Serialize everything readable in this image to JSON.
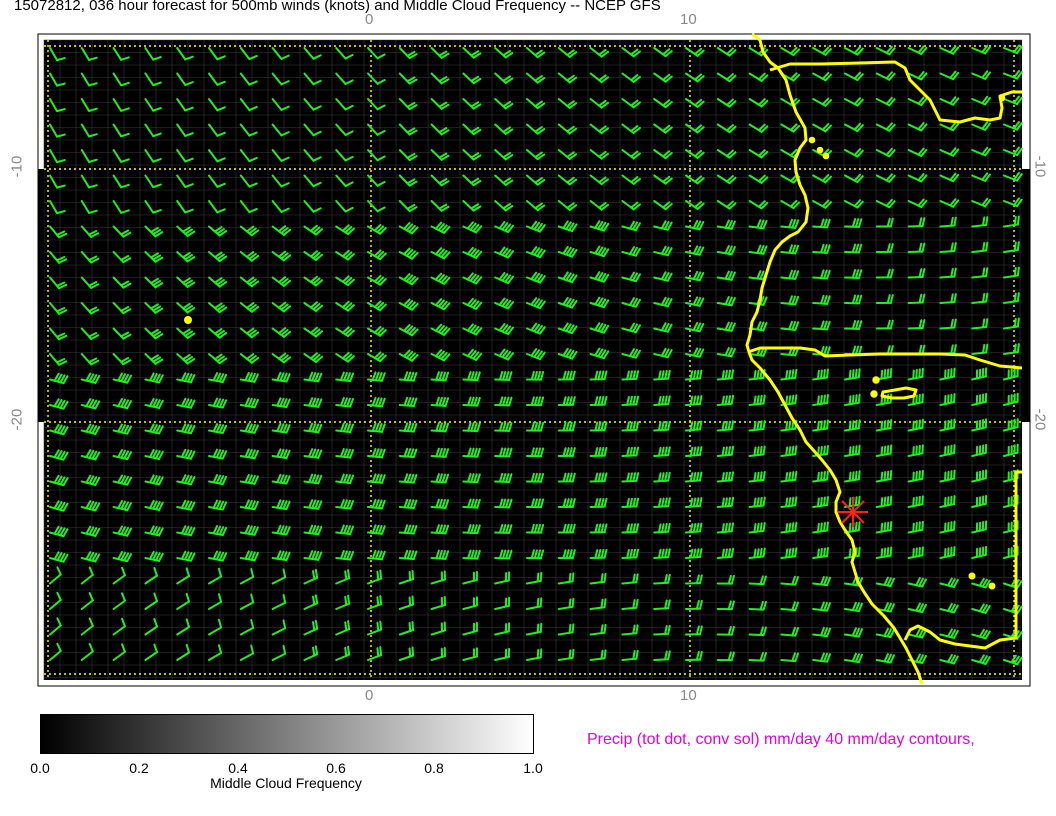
{
  "title": "15072812, 036 hour forecast for 500mb winds (knots) and Middle Cloud Frequency -- NCEP GFS",
  "axes": {
    "top_ticks": [
      "0",
      "10"
    ],
    "bottom_ticks": [
      "0",
      "10"
    ],
    "left_ticks": [
      "-10",
      "-20"
    ],
    "right_ticks": [
      "-10",
      "-20"
    ]
  },
  "colors": {
    "barb": "#22ee22",
    "coast": "#ffff00",
    "grid_dotted": "#ffff00",
    "map_background": "#000000",
    "marker": "#ff2020",
    "precip_text": "#e000e0"
  },
  "colorbar": {
    "ticks": [
      "0.0",
      "0.2",
      "0.4",
      "0.6",
      "0.8",
      "1.0"
    ],
    "label": "Middle Cloud Frequency"
  },
  "precip_note": "Precip (tot dot, conv sol) mm/day 40 mm/day contours,",
  "marker": {
    "icon": "red-star-marker-icon"
  }
}
